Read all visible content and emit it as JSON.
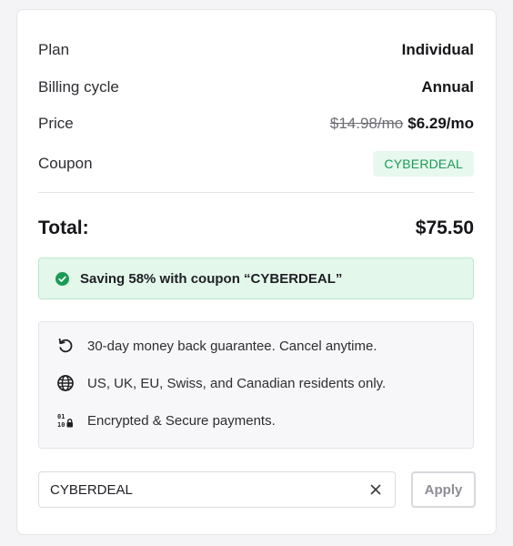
{
  "summary": {
    "plan_label": "Plan",
    "plan_value": "Individual",
    "billing_label": "Billing cycle",
    "billing_value": "Annual",
    "price_label": "Price",
    "price_old": "$14.98/mo",
    "price_new": "$6.29/mo",
    "coupon_label": "Coupon",
    "coupon_badge": "CYBERDEAL"
  },
  "total": {
    "label": "Total:",
    "value": "$75.50"
  },
  "saving": {
    "text": "Saving 58% with coupon “CYBERDEAL”",
    "icon": "check-circle-icon",
    "color": "#1a9b55"
  },
  "info": [
    {
      "icon": "refresh-icon",
      "text": "30-day money back guarantee. Cancel anytime."
    },
    {
      "icon": "globe-icon",
      "text": "US, UK, EU, Swiss, and Canadian residents only."
    },
    {
      "icon": "binary-lock-icon",
      "text": "Encrypted & Secure payments."
    }
  ],
  "coupon_form": {
    "value": "CYBERDEAL",
    "clear_icon": "close-icon",
    "apply_label": "Apply"
  }
}
